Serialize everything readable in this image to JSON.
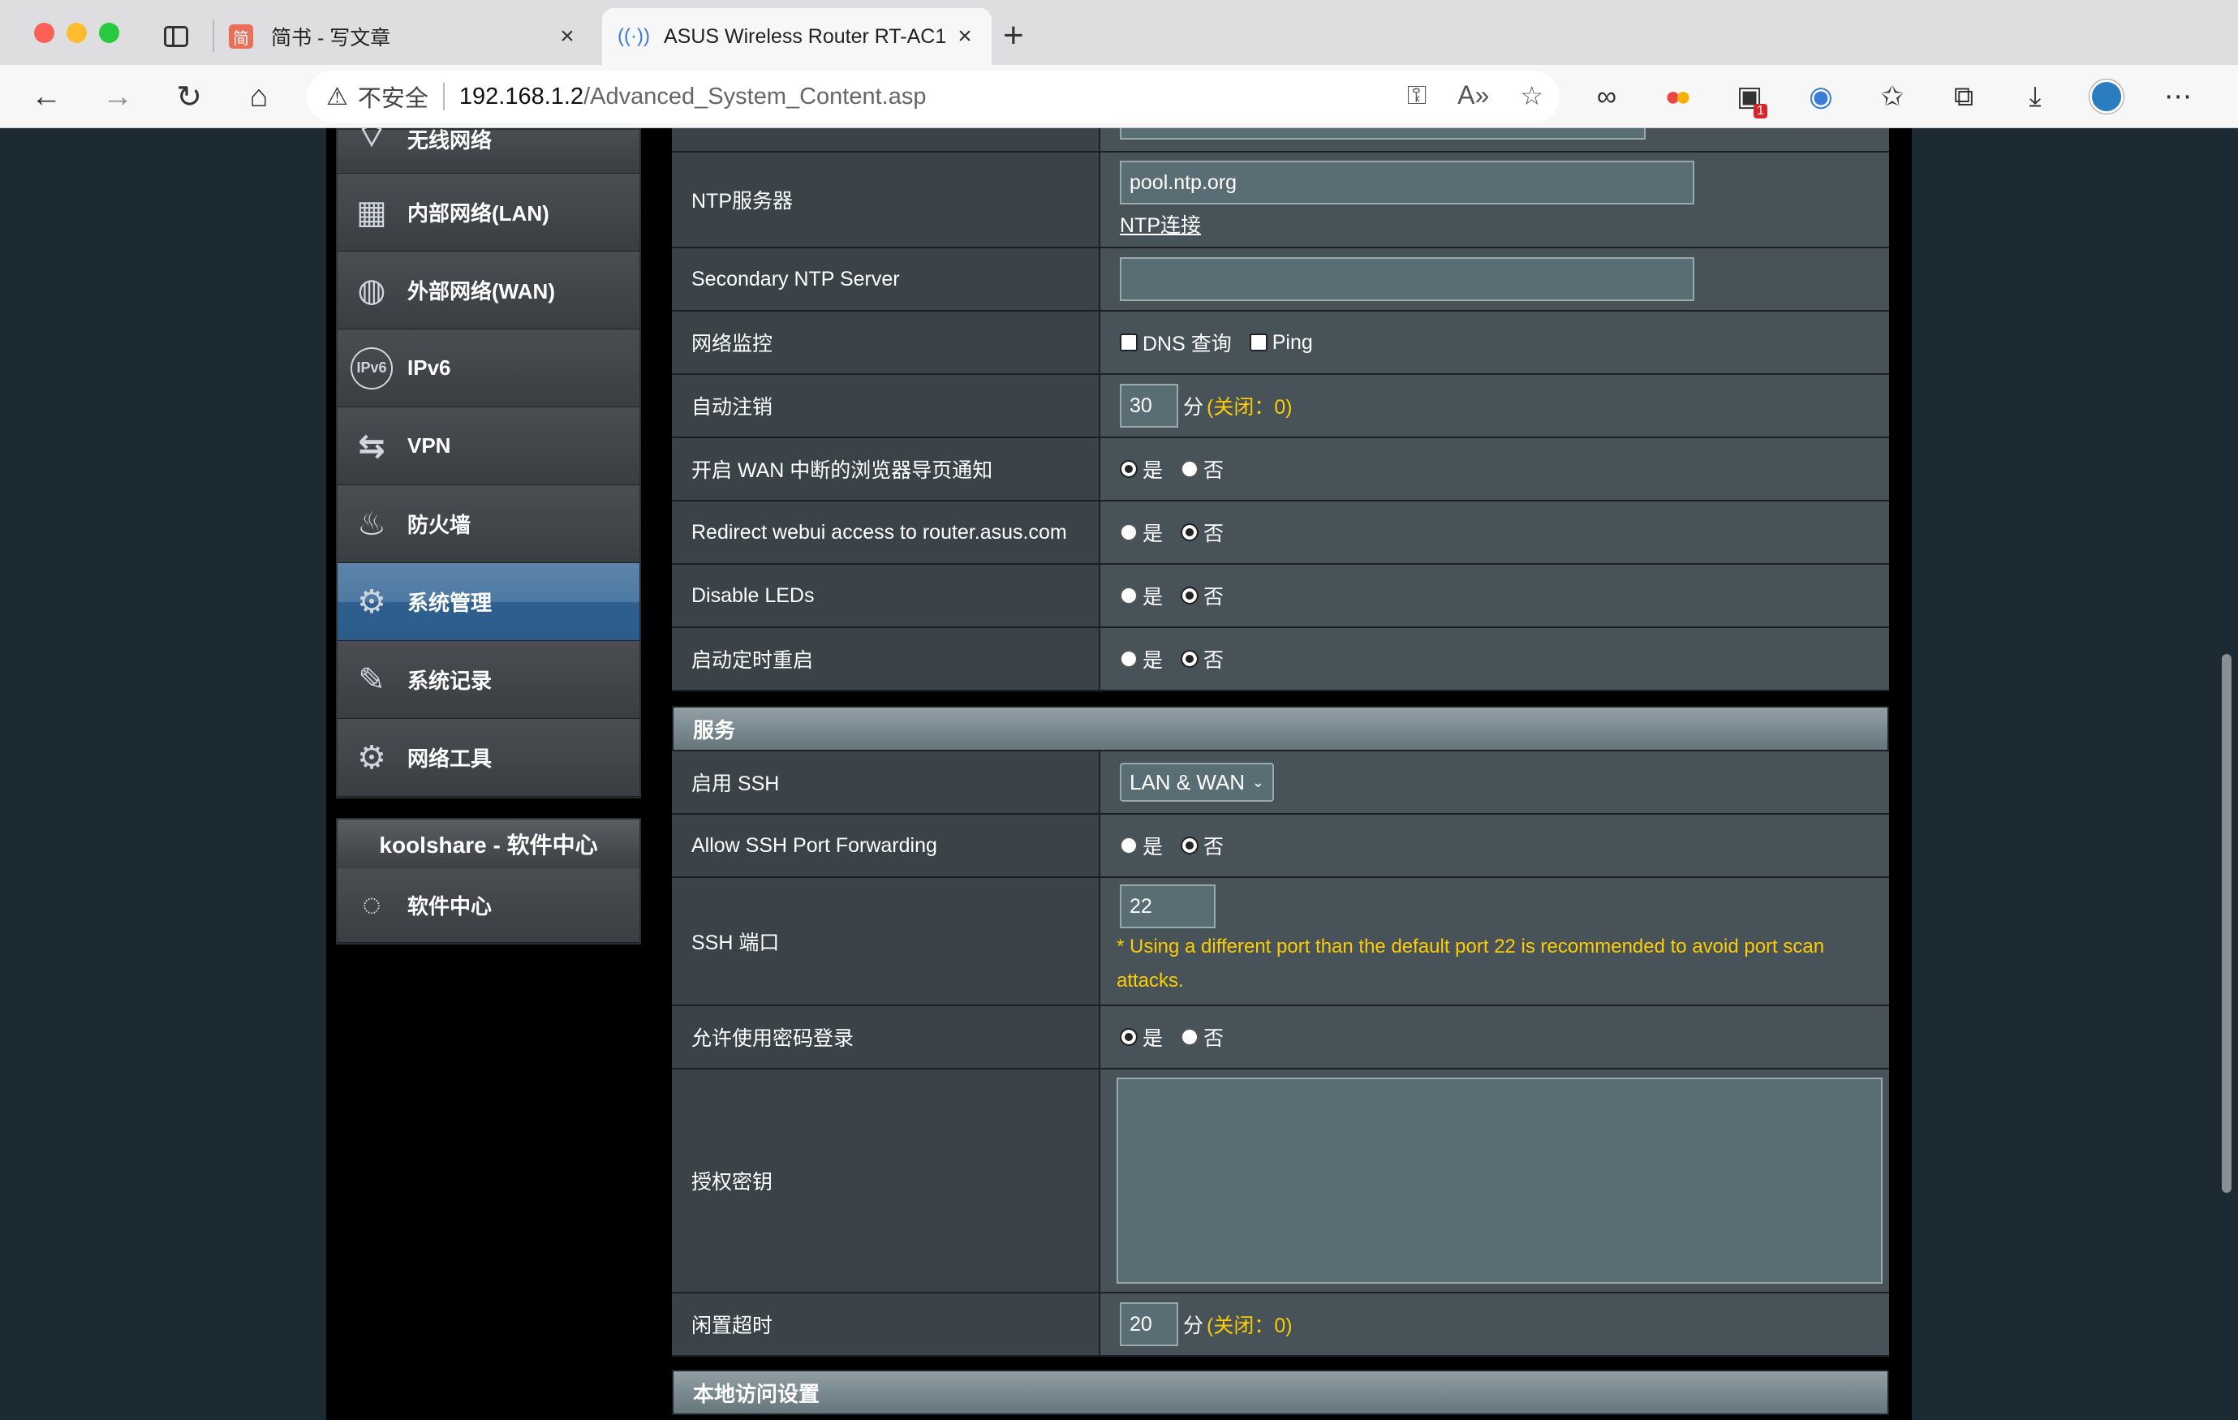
{
  "browser": {
    "tabs": [
      {
        "favicon": "简",
        "title": "简书 - 写文章"
      },
      {
        "favicon": "wifi-icon",
        "title": "ASUS Wireless Router RT-AC1"
      }
    ],
    "security_label": "不安全",
    "url_host": "192.168.1.2",
    "url_path": "/Advanced_System_Content.asp",
    "extension_badge": "1"
  },
  "sidebar": {
    "items": [
      {
        "label": "无线网络",
        "icon": "wifi-icon"
      },
      {
        "label": "内部网络(LAN)",
        "icon": "lan-icon"
      },
      {
        "label": "外部网络(WAN)",
        "icon": "globe-icon"
      },
      {
        "label": "IPv6",
        "icon": "ipv6-icon"
      },
      {
        "label": "VPN",
        "icon": "vpn-icon"
      },
      {
        "label": "防火墙",
        "icon": "firewall-icon"
      },
      {
        "label": "系统管理",
        "icon": "admin-gear-icon",
        "active": true
      },
      {
        "label": "系统记录",
        "icon": "log-icon"
      },
      {
        "label": "网络工具",
        "icon": "tools-gear-icon"
      }
    ],
    "koolshare_title": "koolshare - 软件中心",
    "koolshare_item": "软件中心"
  },
  "settings": {
    "ntp_server_label": "NTP服务器",
    "ntp_server_value": "pool.ntp.org",
    "ntp_link": "NTP连接",
    "secondary_ntp_label": "Secondary NTP Server",
    "secondary_ntp_value": "",
    "network_monitor_label": "网络监控",
    "dns_query": "DNS 查询",
    "ping": "Ping",
    "auto_logout_label": "自动注销",
    "auto_logout_value": "30",
    "minutes": "分",
    "off_hint": "(关闭：0)",
    "wan_notify_label": "开启 WAN 中断的浏览器导页通知",
    "redirect_label": "Redirect webui access to router.asus.com",
    "disable_leds_label": "Disable LEDs",
    "scheduled_reboot_label": "启动定时重启",
    "yes": "是",
    "no": "否"
  },
  "services": {
    "section_title": "服务",
    "ssh_enable_label": "启用 SSH",
    "ssh_enable_value": "LAN & WAN",
    "ssh_forwarding_label": "Allow SSH Port Forwarding",
    "ssh_port_label": "SSH 端口",
    "ssh_port_value": "22",
    "ssh_port_hint": "* Using a different port than the default port 22 is recommended to avoid port scan attacks.",
    "password_login_label": "允许使用密码登录",
    "auth_key_label": "授权密钥",
    "idle_timeout_label": "闲置超时",
    "idle_timeout_value": "20"
  },
  "local_access": {
    "section_title": "本地访问设置"
  }
}
